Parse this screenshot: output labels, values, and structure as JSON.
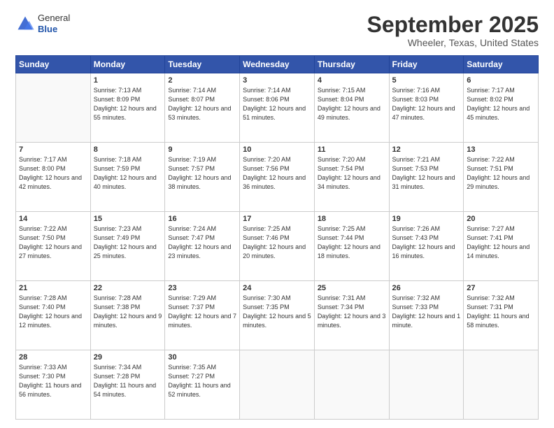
{
  "header": {
    "logo": {
      "general": "General",
      "blue": "Blue"
    },
    "title": "September 2025",
    "location": "Wheeler, Texas, United States"
  },
  "weekdays": [
    "Sunday",
    "Monday",
    "Tuesday",
    "Wednesday",
    "Thursday",
    "Friday",
    "Saturday"
  ],
  "weeks": [
    [
      {
        "day": "",
        "empty": true
      },
      {
        "day": "1",
        "sunrise": "Sunrise: 7:13 AM",
        "sunset": "Sunset: 8:09 PM",
        "daylight": "Daylight: 12 hours and 55 minutes."
      },
      {
        "day": "2",
        "sunrise": "Sunrise: 7:14 AM",
        "sunset": "Sunset: 8:07 PM",
        "daylight": "Daylight: 12 hours and 53 minutes."
      },
      {
        "day": "3",
        "sunrise": "Sunrise: 7:14 AM",
        "sunset": "Sunset: 8:06 PM",
        "daylight": "Daylight: 12 hours and 51 minutes."
      },
      {
        "day": "4",
        "sunrise": "Sunrise: 7:15 AM",
        "sunset": "Sunset: 8:04 PM",
        "daylight": "Daylight: 12 hours and 49 minutes."
      },
      {
        "day": "5",
        "sunrise": "Sunrise: 7:16 AM",
        "sunset": "Sunset: 8:03 PM",
        "daylight": "Daylight: 12 hours and 47 minutes."
      },
      {
        "day": "6",
        "sunrise": "Sunrise: 7:17 AM",
        "sunset": "Sunset: 8:02 PM",
        "daylight": "Daylight: 12 hours and 45 minutes."
      }
    ],
    [
      {
        "day": "7",
        "sunrise": "Sunrise: 7:17 AM",
        "sunset": "Sunset: 8:00 PM",
        "daylight": "Daylight: 12 hours and 42 minutes."
      },
      {
        "day": "8",
        "sunrise": "Sunrise: 7:18 AM",
        "sunset": "Sunset: 7:59 PM",
        "daylight": "Daylight: 12 hours and 40 minutes."
      },
      {
        "day": "9",
        "sunrise": "Sunrise: 7:19 AM",
        "sunset": "Sunset: 7:57 PM",
        "daylight": "Daylight: 12 hours and 38 minutes."
      },
      {
        "day": "10",
        "sunrise": "Sunrise: 7:20 AM",
        "sunset": "Sunset: 7:56 PM",
        "daylight": "Daylight: 12 hours and 36 minutes."
      },
      {
        "day": "11",
        "sunrise": "Sunrise: 7:20 AM",
        "sunset": "Sunset: 7:54 PM",
        "daylight": "Daylight: 12 hours and 34 minutes."
      },
      {
        "day": "12",
        "sunrise": "Sunrise: 7:21 AM",
        "sunset": "Sunset: 7:53 PM",
        "daylight": "Daylight: 12 hours and 31 minutes."
      },
      {
        "day": "13",
        "sunrise": "Sunrise: 7:22 AM",
        "sunset": "Sunset: 7:51 PM",
        "daylight": "Daylight: 12 hours and 29 minutes."
      }
    ],
    [
      {
        "day": "14",
        "sunrise": "Sunrise: 7:22 AM",
        "sunset": "Sunset: 7:50 PM",
        "daylight": "Daylight: 12 hours and 27 minutes."
      },
      {
        "day": "15",
        "sunrise": "Sunrise: 7:23 AM",
        "sunset": "Sunset: 7:49 PM",
        "daylight": "Daylight: 12 hours and 25 minutes."
      },
      {
        "day": "16",
        "sunrise": "Sunrise: 7:24 AM",
        "sunset": "Sunset: 7:47 PM",
        "daylight": "Daylight: 12 hours and 23 minutes."
      },
      {
        "day": "17",
        "sunrise": "Sunrise: 7:25 AM",
        "sunset": "Sunset: 7:46 PM",
        "daylight": "Daylight: 12 hours and 20 minutes."
      },
      {
        "day": "18",
        "sunrise": "Sunrise: 7:25 AM",
        "sunset": "Sunset: 7:44 PM",
        "daylight": "Daylight: 12 hours and 18 minutes."
      },
      {
        "day": "19",
        "sunrise": "Sunrise: 7:26 AM",
        "sunset": "Sunset: 7:43 PM",
        "daylight": "Daylight: 12 hours and 16 minutes."
      },
      {
        "day": "20",
        "sunrise": "Sunrise: 7:27 AM",
        "sunset": "Sunset: 7:41 PM",
        "daylight": "Daylight: 12 hours and 14 minutes."
      }
    ],
    [
      {
        "day": "21",
        "sunrise": "Sunrise: 7:28 AM",
        "sunset": "Sunset: 7:40 PM",
        "daylight": "Daylight: 12 hours and 12 minutes."
      },
      {
        "day": "22",
        "sunrise": "Sunrise: 7:28 AM",
        "sunset": "Sunset: 7:38 PM",
        "daylight": "Daylight: 12 hours and 9 minutes."
      },
      {
        "day": "23",
        "sunrise": "Sunrise: 7:29 AM",
        "sunset": "Sunset: 7:37 PM",
        "daylight": "Daylight: 12 hours and 7 minutes."
      },
      {
        "day": "24",
        "sunrise": "Sunrise: 7:30 AM",
        "sunset": "Sunset: 7:35 PM",
        "daylight": "Daylight: 12 hours and 5 minutes."
      },
      {
        "day": "25",
        "sunrise": "Sunrise: 7:31 AM",
        "sunset": "Sunset: 7:34 PM",
        "daylight": "Daylight: 12 hours and 3 minutes."
      },
      {
        "day": "26",
        "sunrise": "Sunrise: 7:32 AM",
        "sunset": "Sunset: 7:33 PM",
        "daylight": "Daylight: 12 hours and 1 minute."
      },
      {
        "day": "27",
        "sunrise": "Sunrise: 7:32 AM",
        "sunset": "Sunset: 7:31 PM",
        "daylight": "Daylight: 11 hours and 58 minutes."
      }
    ],
    [
      {
        "day": "28",
        "sunrise": "Sunrise: 7:33 AM",
        "sunset": "Sunset: 7:30 PM",
        "daylight": "Daylight: 11 hours and 56 minutes."
      },
      {
        "day": "29",
        "sunrise": "Sunrise: 7:34 AM",
        "sunset": "Sunset: 7:28 PM",
        "daylight": "Daylight: 11 hours and 54 minutes."
      },
      {
        "day": "30",
        "sunrise": "Sunrise: 7:35 AM",
        "sunset": "Sunset: 7:27 PM",
        "daylight": "Daylight: 11 hours and 52 minutes."
      },
      {
        "day": "",
        "empty": true
      },
      {
        "day": "",
        "empty": true
      },
      {
        "day": "",
        "empty": true
      },
      {
        "day": "",
        "empty": true
      }
    ]
  ]
}
